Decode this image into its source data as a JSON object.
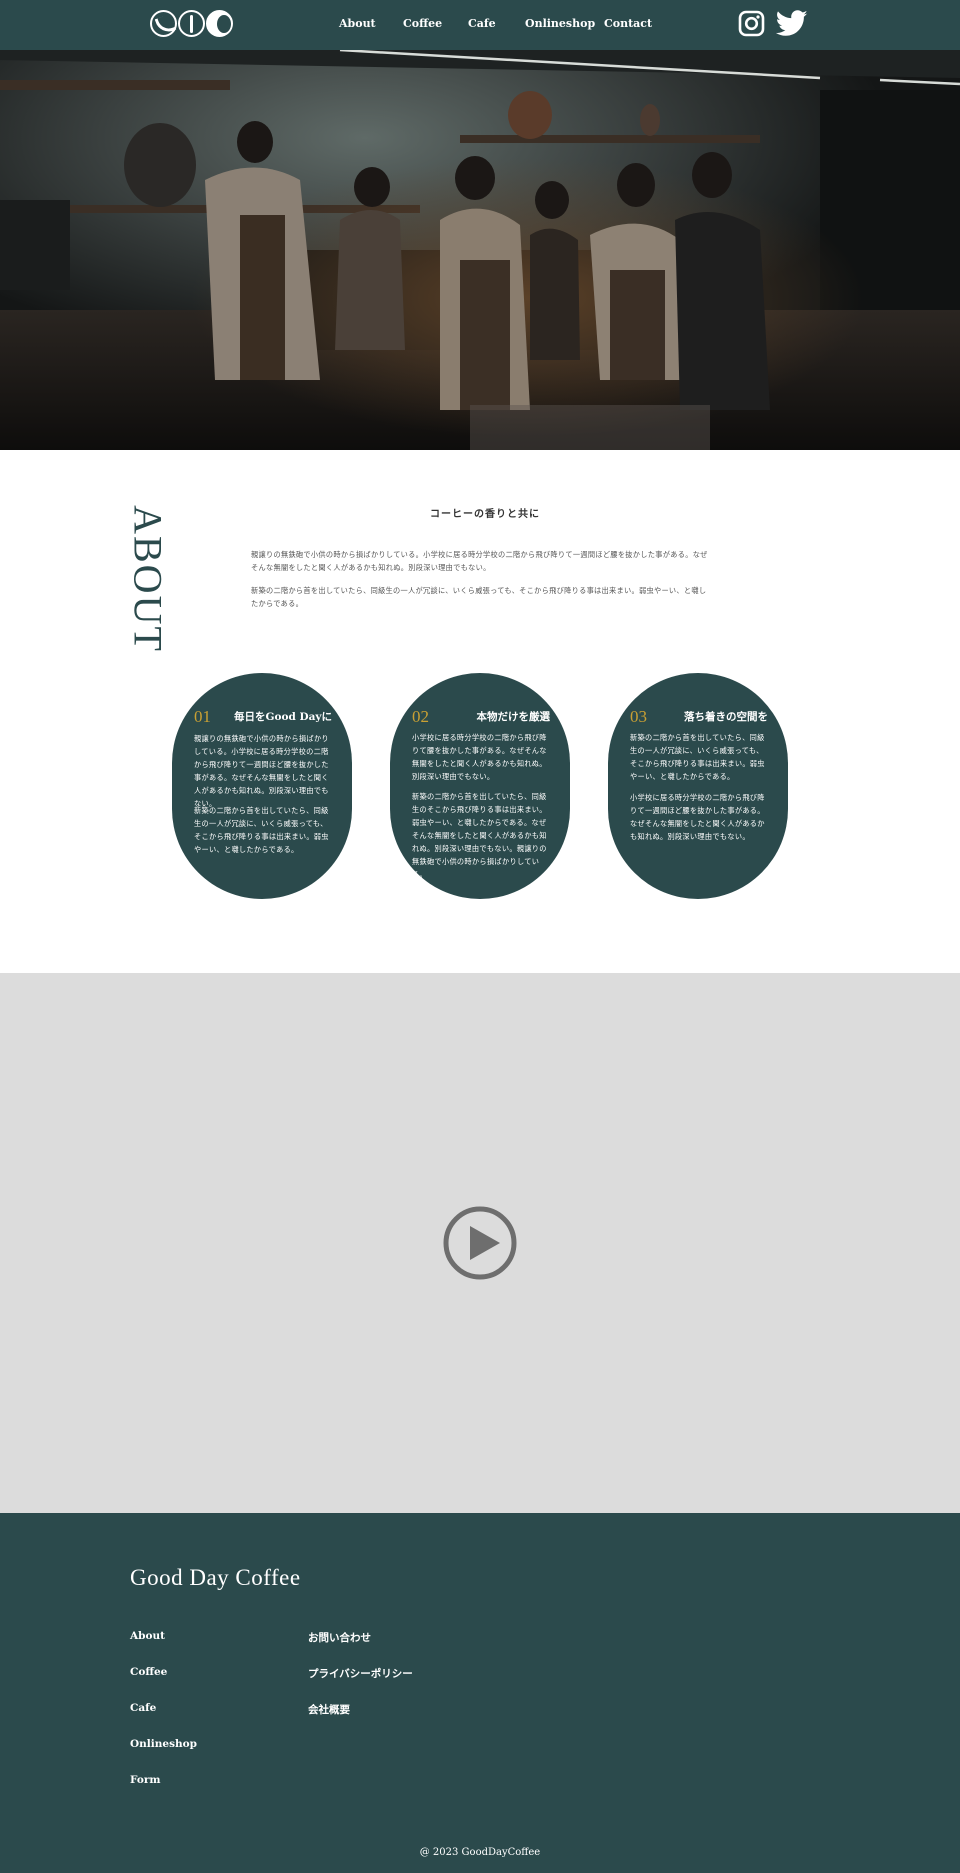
{
  "header": {
    "brand_icons": [
      "coffee-cup-icon",
      "coffee-cup-icon",
      "coffee-cup-icon"
    ],
    "nav": [
      "About",
      "Coffee",
      "Cafe",
      "Onlineshop",
      "Contact"
    ],
    "social_icons": [
      "instagram-icon",
      "twitter-icon"
    ]
  },
  "hero": {
    "image": "cafe-staff-photo"
  },
  "about": {
    "title": "ABOUT",
    "heading": "コーヒーの香りと共に",
    "paragraphs": [
      "親譲りの無鉄砲で小供の時から損ばかりしている。小学校に居る時分学校の二階から飛び降りて一週間ほど腰を抜かした事がある。なぜそんな無闇をしたと聞く人があるかも知れぬ。別段深い理由でもない。",
      "新築の二階から首を出していたら、同級生の一人が冗談に、いくら威張っても、そこから飛び降りる事は出来まい。弱虫やーい、と囃したからである。"
    ]
  },
  "cards": [
    {
      "num": "01",
      "title": "毎日をGood Dayに",
      "paragraphs": [
        "親譲りの無鉄砲で小供の時から損ばかりしている。小学校に居る時分学校の二階から飛び降りて一週間ほど腰を抜かした事がある。なぜそんな無闇をしたと聞く人があるかも知れぬ。別段深い理由でもない。",
        "新築の二階から首を出していたら、同級生の一人が冗談に、いくら威張っても、そこから飛び降りる事は出来まい。弱虫やーい、と囃したからである。"
      ]
    },
    {
      "num": "02",
      "title": "本物だけを厳選",
      "paragraphs": [
        "小学校に居る時分学校の二階から飛び降りて腰を抜かした事がある。なぜそんな無闇をしたと聞く人があるかも知れぬ。別段深い理由でもない。",
        "新築の二階から首を出していたら、同級生のそこから飛び降りる事は出来まい。弱虫やーい、と囃したからである。なぜそんな無闇をしたと聞く人があるかも知れぬ。別段深い理由でもない。親譲りの無鉄砲で小供の時から損ばかりしている。"
      ]
    },
    {
      "num": "03",
      "title": "落ち着きの空間を",
      "paragraphs": [
        "新築の二階から首を出していたら、同級生の一人が冗談に、いくら威張っても、そこから飛び降りる事は出来まい。弱虫やーい、と囃したからである。",
        "小学校に居る時分学校の二階から飛び降りて一週間ほど腰を抜かした事がある。なぜそんな無闇をしたと聞く人があるかも知れぬ。別段深い理由でもない。"
      ]
    }
  ],
  "video": {
    "play_icon": "play-icon"
  },
  "footer": {
    "brand": "Good Day Coffee",
    "col1": [
      "About",
      "Coffee",
      "Cafe",
      "Onlineshop",
      "Form"
    ],
    "col2": [
      "お問い合わせ",
      "プライバシーポリシー",
      "会社概要"
    ],
    "copyright": "@ 2023 GoodDayCoffee"
  },
  "colors": {
    "primary": "#2b4a4c",
    "accent": "#c9a033",
    "video_bg": "#dcdcdc"
  }
}
